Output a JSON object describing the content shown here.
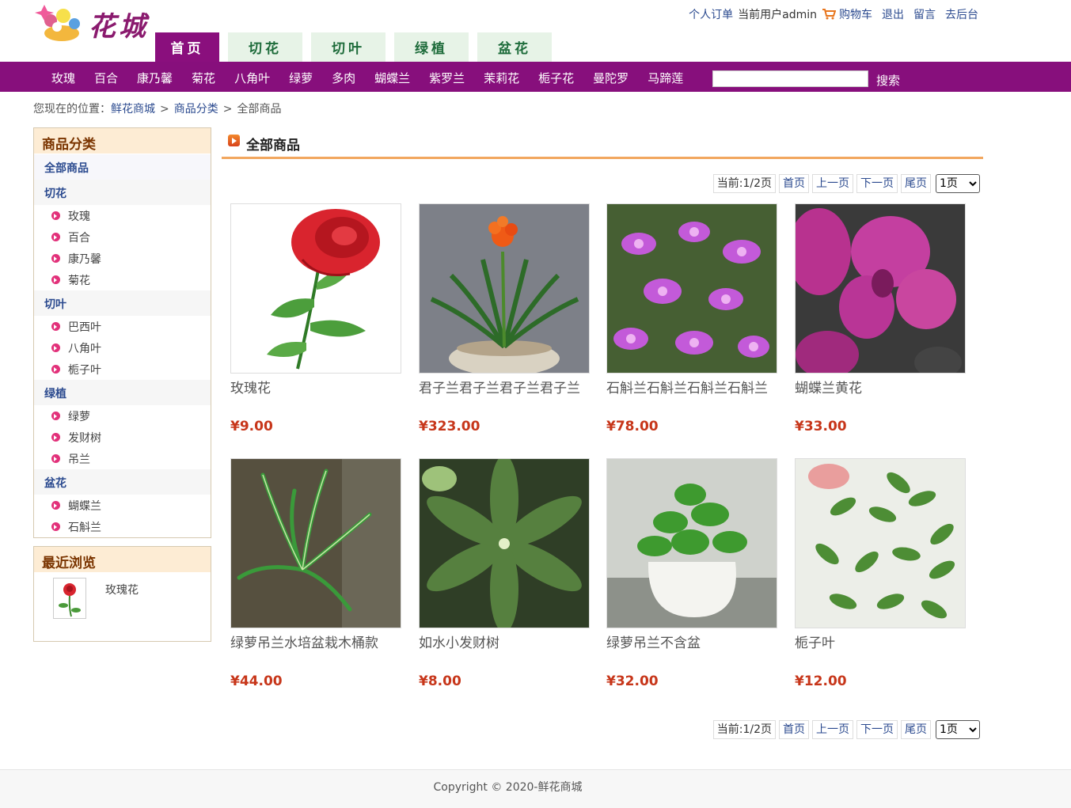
{
  "header": {
    "logo_text": "花城",
    "links": {
      "orders": "个人订单",
      "current_user": "当前用户admin",
      "cart": "购物车",
      "logout": "退出",
      "message": "留言",
      "admin": "去后台"
    }
  },
  "nav_tabs": [
    "首页",
    "切花",
    "切叶",
    "绿植",
    "盆花"
  ],
  "category_bar": {
    "links": [
      "玫瑰",
      "百合",
      "康乃馨",
      "菊花",
      "八角叶",
      "绿萝",
      "多肉",
      "蝴蝶兰",
      "紫罗兰",
      "茉莉花",
      "栀子花",
      "曼陀罗",
      "马蹄莲"
    ],
    "search_value": "",
    "search_button": "搜索"
  },
  "breadcrumb": {
    "prefix": "您现在的位置：",
    "items": [
      "鲜花商城",
      "商品分类",
      "全部商品"
    ],
    "separator": ">"
  },
  "sidebar": {
    "title": "商品分类",
    "all_label": "全部商品",
    "groups": [
      {
        "name": "切花",
        "items": [
          "玫瑰",
          "百合",
          "康乃馨",
          "菊花"
        ]
      },
      {
        "name": "切叶",
        "items": [
          "巴西叶",
          "八角叶",
          "栀子叶"
        ]
      },
      {
        "name": "绿植",
        "items": [
          "绿萝",
          "发财树",
          "吊兰"
        ]
      },
      {
        "name": "盆花",
        "items": [
          "蝴蝶兰",
          "石斛兰"
        ]
      }
    ]
  },
  "recent": {
    "title": "最近浏览",
    "item": "玫瑰花"
  },
  "main": {
    "title": "全部商品",
    "pager": {
      "current": "当前:1/2页",
      "first": "首页",
      "prev": "上一页",
      "next": "下一页",
      "last": "尾页",
      "select_value": "1页"
    },
    "products": [
      {
        "name": "玫瑰花",
        "price": "¥9.00",
        "image": "red-rose"
      },
      {
        "name": "君子兰君子兰君子兰君子兰",
        "price": "¥323.00",
        "image": "clivia-potted"
      },
      {
        "name": "石斛兰石斛兰石斛兰石斛兰",
        "price": "¥78.00",
        "image": "purple-dendrobium"
      },
      {
        "name": "蝴蝶兰黄花",
        "price": "¥33.00",
        "image": "magenta-orchid"
      },
      {
        "name": "绿萝吊兰水培盆栽木桶款",
        "price": "¥44.00",
        "image": "spider-plant"
      },
      {
        "name": "如水小发财树",
        "price": "¥8.00",
        "image": "money-tree-leaves"
      },
      {
        "name": "绿萝吊兰不含盆",
        "price": "¥32.00",
        "image": "pothos-pot"
      },
      {
        "name": "栀子叶",
        "price": "¥12.00",
        "image": "gardenia-leaves"
      }
    ]
  },
  "footer": {
    "text": "Copyright © 2020-鲜花商城"
  },
  "colors": {
    "brand_purple": "#870f7c",
    "tab_green_bg": "#e7f3e7",
    "price_red": "#c7361a",
    "accent_orange": "#f2a75f"
  }
}
